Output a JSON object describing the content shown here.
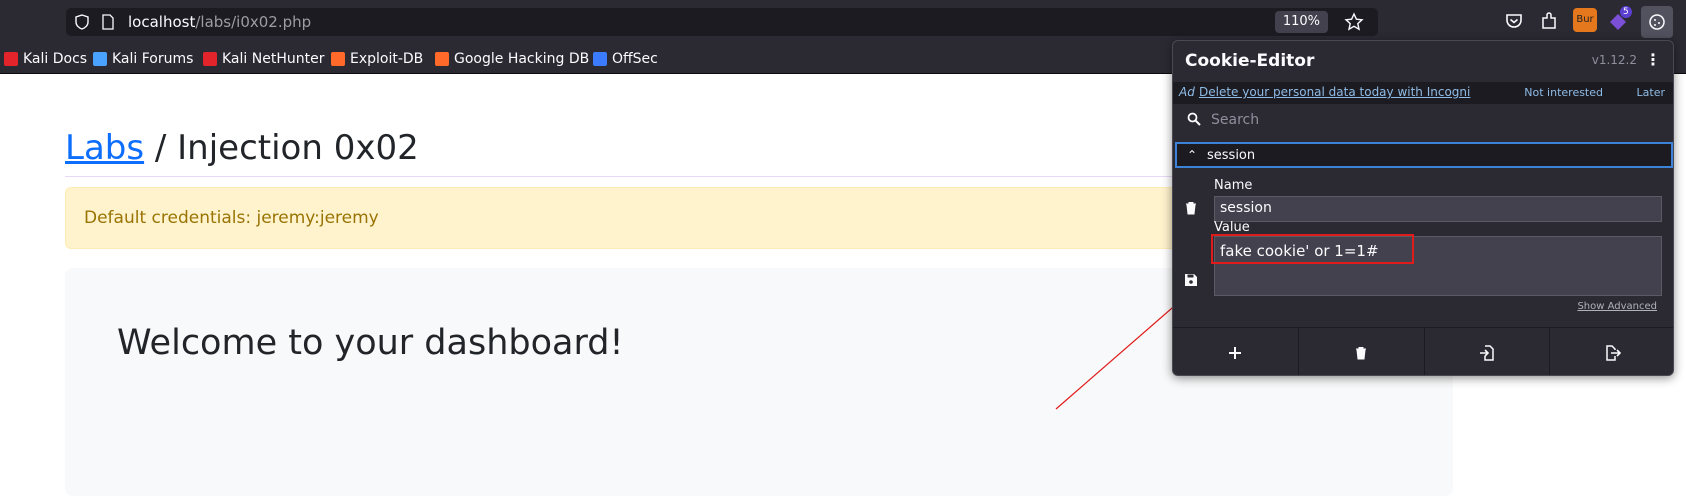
{
  "browser": {
    "url_host": "localhost",
    "url_path": "/labs/i0x02.php",
    "zoom": "110%",
    "extension_badge": "5",
    "burp_label": "Bur"
  },
  "bookmarks": [
    {
      "label": "Kali Docs",
      "color": "#e3242b"
    },
    {
      "label": "Kali Forums",
      "color": "#4aa3ff"
    },
    {
      "label": "Kali NetHunter",
      "color": "#e3242b"
    },
    {
      "label": "Exploit-DB",
      "color": "#ff6a2b"
    },
    {
      "label": "Google Hacking DB",
      "color": "#ff6a2b"
    },
    {
      "label": "OffSec",
      "color": "#3a7bff"
    }
  ],
  "page": {
    "breadcrumb_link": "Labs",
    "breadcrumb_rest": " / Injection 0x02",
    "alert_text": "Default credentials: jeremy:jeremy",
    "welcome": "Welcome to your dashboard!"
  },
  "cookie_editor": {
    "title": "Cookie-Editor",
    "version": "v1.12.2",
    "ad_tag": "Ad",
    "ad_link": "Delete your personal data today with Incogni",
    "ad_not_interested": "Not interested",
    "ad_later": "Later",
    "search_placeholder": "Search",
    "cookie_name": "session",
    "name_label": "Name",
    "name_value": "session",
    "value_label": "Value",
    "value_value": "fake cookie' or 1=1#",
    "show_advanced": "Show Advanced"
  },
  "colors": {
    "accent": "#0d6efd",
    "highlight": "#e01b1b",
    "focus": "#3b82d8"
  }
}
